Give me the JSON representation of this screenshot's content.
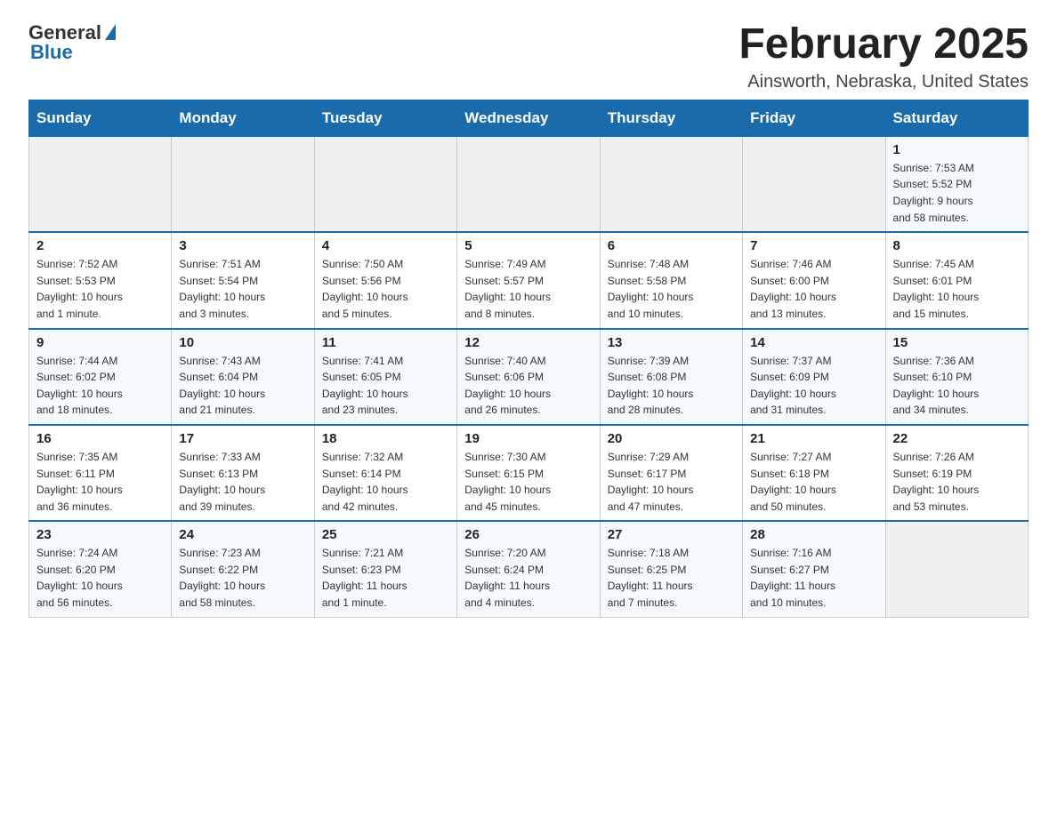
{
  "logo": {
    "general": "General",
    "blue": "Blue"
  },
  "title": "February 2025",
  "location": "Ainsworth, Nebraska, United States",
  "days_of_week": [
    "Sunday",
    "Monday",
    "Tuesday",
    "Wednesday",
    "Thursday",
    "Friday",
    "Saturday"
  ],
  "weeks": [
    [
      {
        "day": "",
        "info": ""
      },
      {
        "day": "",
        "info": ""
      },
      {
        "day": "",
        "info": ""
      },
      {
        "day": "",
        "info": ""
      },
      {
        "day": "",
        "info": ""
      },
      {
        "day": "",
        "info": ""
      },
      {
        "day": "1",
        "info": "Sunrise: 7:53 AM\nSunset: 5:52 PM\nDaylight: 9 hours\nand 58 minutes."
      }
    ],
    [
      {
        "day": "2",
        "info": "Sunrise: 7:52 AM\nSunset: 5:53 PM\nDaylight: 10 hours\nand 1 minute."
      },
      {
        "day": "3",
        "info": "Sunrise: 7:51 AM\nSunset: 5:54 PM\nDaylight: 10 hours\nand 3 minutes."
      },
      {
        "day": "4",
        "info": "Sunrise: 7:50 AM\nSunset: 5:56 PM\nDaylight: 10 hours\nand 5 minutes."
      },
      {
        "day": "5",
        "info": "Sunrise: 7:49 AM\nSunset: 5:57 PM\nDaylight: 10 hours\nand 8 minutes."
      },
      {
        "day": "6",
        "info": "Sunrise: 7:48 AM\nSunset: 5:58 PM\nDaylight: 10 hours\nand 10 minutes."
      },
      {
        "day": "7",
        "info": "Sunrise: 7:46 AM\nSunset: 6:00 PM\nDaylight: 10 hours\nand 13 minutes."
      },
      {
        "day": "8",
        "info": "Sunrise: 7:45 AM\nSunset: 6:01 PM\nDaylight: 10 hours\nand 15 minutes."
      }
    ],
    [
      {
        "day": "9",
        "info": "Sunrise: 7:44 AM\nSunset: 6:02 PM\nDaylight: 10 hours\nand 18 minutes."
      },
      {
        "day": "10",
        "info": "Sunrise: 7:43 AM\nSunset: 6:04 PM\nDaylight: 10 hours\nand 21 minutes."
      },
      {
        "day": "11",
        "info": "Sunrise: 7:41 AM\nSunset: 6:05 PM\nDaylight: 10 hours\nand 23 minutes."
      },
      {
        "day": "12",
        "info": "Sunrise: 7:40 AM\nSunset: 6:06 PM\nDaylight: 10 hours\nand 26 minutes."
      },
      {
        "day": "13",
        "info": "Sunrise: 7:39 AM\nSunset: 6:08 PM\nDaylight: 10 hours\nand 28 minutes."
      },
      {
        "day": "14",
        "info": "Sunrise: 7:37 AM\nSunset: 6:09 PM\nDaylight: 10 hours\nand 31 minutes."
      },
      {
        "day": "15",
        "info": "Sunrise: 7:36 AM\nSunset: 6:10 PM\nDaylight: 10 hours\nand 34 minutes."
      }
    ],
    [
      {
        "day": "16",
        "info": "Sunrise: 7:35 AM\nSunset: 6:11 PM\nDaylight: 10 hours\nand 36 minutes."
      },
      {
        "day": "17",
        "info": "Sunrise: 7:33 AM\nSunset: 6:13 PM\nDaylight: 10 hours\nand 39 minutes."
      },
      {
        "day": "18",
        "info": "Sunrise: 7:32 AM\nSunset: 6:14 PM\nDaylight: 10 hours\nand 42 minutes."
      },
      {
        "day": "19",
        "info": "Sunrise: 7:30 AM\nSunset: 6:15 PM\nDaylight: 10 hours\nand 45 minutes."
      },
      {
        "day": "20",
        "info": "Sunrise: 7:29 AM\nSunset: 6:17 PM\nDaylight: 10 hours\nand 47 minutes."
      },
      {
        "day": "21",
        "info": "Sunrise: 7:27 AM\nSunset: 6:18 PM\nDaylight: 10 hours\nand 50 minutes."
      },
      {
        "day": "22",
        "info": "Sunrise: 7:26 AM\nSunset: 6:19 PM\nDaylight: 10 hours\nand 53 minutes."
      }
    ],
    [
      {
        "day": "23",
        "info": "Sunrise: 7:24 AM\nSunset: 6:20 PM\nDaylight: 10 hours\nand 56 minutes."
      },
      {
        "day": "24",
        "info": "Sunrise: 7:23 AM\nSunset: 6:22 PM\nDaylight: 10 hours\nand 58 minutes."
      },
      {
        "day": "25",
        "info": "Sunrise: 7:21 AM\nSunset: 6:23 PM\nDaylight: 11 hours\nand 1 minute."
      },
      {
        "day": "26",
        "info": "Sunrise: 7:20 AM\nSunset: 6:24 PM\nDaylight: 11 hours\nand 4 minutes."
      },
      {
        "day": "27",
        "info": "Sunrise: 7:18 AM\nSunset: 6:25 PM\nDaylight: 11 hours\nand 7 minutes."
      },
      {
        "day": "28",
        "info": "Sunrise: 7:16 AM\nSunset: 6:27 PM\nDaylight: 11 hours\nand 10 minutes."
      },
      {
        "day": "",
        "info": ""
      }
    ]
  ]
}
